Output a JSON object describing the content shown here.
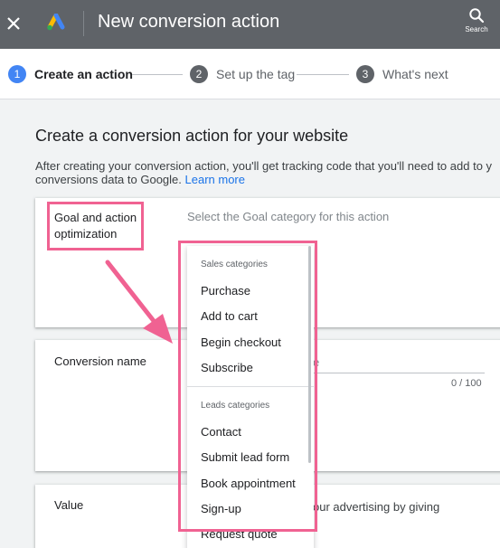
{
  "topbar": {
    "title": "New conversion action",
    "search_label": "Search",
    "icons": [
      "close-icon",
      "google-ads-logo",
      "search-icon"
    ]
  },
  "stepper": {
    "steps": [
      {
        "number": "1",
        "label": "Create an action",
        "active": true
      },
      {
        "number": "2",
        "label": "Set up the tag",
        "active": false
      },
      {
        "number": "3",
        "label": "What's next",
        "active": false
      }
    ]
  },
  "main": {
    "heading": "Create a conversion action for your website",
    "description_line1": "After creating your conversion action, you'll get tracking code that you'll need to add to y",
    "description_line2": "conversions data to Google. ",
    "learn_more": "Learn more"
  },
  "goal_section": {
    "label_line1": "Goal and action",
    "label_line2": "optimization",
    "placeholder": "Select the Goal category for this action"
  },
  "conversion_name_section": {
    "label": "Conversion name",
    "value_fragment": "e",
    "char_count": "0 / 100"
  },
  "value_section": {
    "label": "Value",
    "description_fragment": "our advertising by giving"
  },
  "dropdown": {
    "sales_header": "Sales categories",
    "sales_items": [
      "Purchase",
      "Add to cart",
      "Begin checkout",
      "Subscribe"
    ],
    "leads_header": "Leads categories",
    "leads_items": [
      "Contact",
      "Submit lead form",
      "Book appointment",
      "Sign-up",
      "Request quote"
    ]
  },
  "colors": {
    "topbar": "#5f6368",
    "accent": "#4285f4",
    "link": "#1a73e8",
    "annotation": "#f06292"
  }
}
